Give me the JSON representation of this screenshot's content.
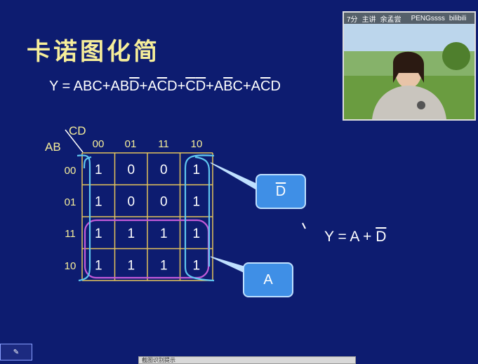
{
  "slide": {
    "title": "卡诺图化简",
    "expression": {
      "lhs": "Y = ",
      "terms": [
        {
          "parts": [
            {
              "t": "ABC",
              "bar": false
            }
          ]
        },
        {
          "parts": [
            {
              "t": "AB",
              "bar": false
            },
            {
              "t": "D",
              "bar": true
            }
          ]
        },
        {
          "parts": [
            {
              "t": "A",
              "bar": false
            },
            {
              "t": "C",
              "bar": true
            },
            {
              "t": "D",
              "bar": false
            }
          ]
        },
        {
          "parts": [
            {
              "t": "C",
              "bar": true
            },
            {
              "t": "D",
              "bar": true
            }
          ]
        },
        {
          "parts": [
            {
              "t": "A",
              "bar": false
            },
            {
              "t": "B",
              "bar": true
            },
            {
              "t": "C",
              "bar": false
            }
          ]
        },
        {
          "parts": [
            {
              "t": "A",
              "bar": false
            },
            {
              "t": "C",
              "bar": true
            },
            {
              "t": "D",
              "bar": false
            }
          ]
        }
      ]
    },
    "kmap": {
      "col_var": "CD",
      "row_var": "AB",
      "col_labels": [
        "00",
        "01",
        "11",
        "10"
      ],
      "row_labels": [
        "00",
        "01",
        "11",
        "10"
      ],
      "cells": [
        [
          "1",
          "0",
          "0",
          "1"
        ],
        [
          "1",
          "0",
          "0",
          "1"
        ],
        [
          "1",
          "1",
          "1",
          "1"
        ],
        [
          "1",
          "1",
          "1",
          "1"
        ]
      ]
    },
    "callouts": {
      "d_bar": "D",
      "a": "A"
    },
    "result": {
      "prefix": "Y = A + ",
      "term": "D"
    },
    "colors": {
      "background": "#0d1c70",
      "title": "#f6ee9a",
      "grid": "#e5c35a",
      "group_a": "#c35bd9",
      "group_dbar": "#5fc6f0",
      "callout": "#3f8fe6"
    }
  },
  "video": {
    "bar_items": [
      "7分",
      "主讲",
      "余孟尝"
    ],
    "watermark": "PENGssss",
    "logo": "bilibili"
  },
  "bottom_tab": {
    "label": "截图识别提示"
  }
}
